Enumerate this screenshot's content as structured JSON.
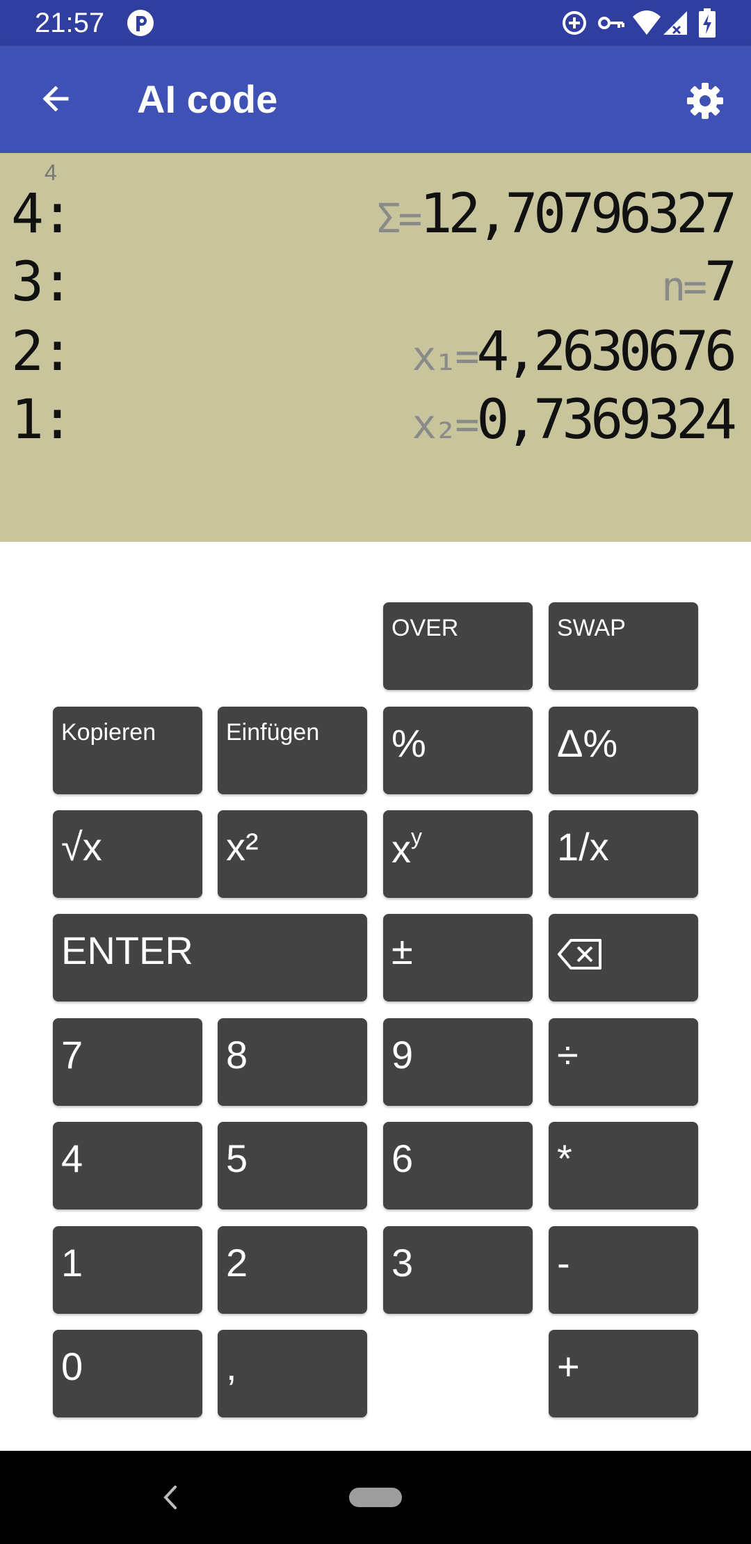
{
  "status_bar": {
    "time": "21:57",
    "icons": [
      "app-notification-icon",
      "data-saver-icon",
      "vpn-key-icon",
      "wifi-icon",
      "cell-signal-icon",
      "battery-charging-icon"
    ]
  },
  "app_bar": {
    "title": "AI code",
    "icons": [
      "back-arrow-icon",
      "gear-icon"
    ]
  },
  "display": {
    "stack_depth": "4",
    "stack": [
      {
        "index": "4:",
        "label": "Σ=",
        "value": "12,70796327"
      },
      {
        "index": "3:",
        "label": "n=",
        "value": "7"
      },
      {
        "index": "2:",
        "label": "x₁=",
        "value": "4,2630676"
      },
      {
        "index": "1:",
        "label": "x₂=",
        "value": "0,7369324"
      }
    ]
  },
  "keypad": {
    "over": "OVER",
    "swap": "SWAP",
    "kopieren": "Kopieren",
    "einfuegen": "Einfügen",
    "percent": "%",
    "delta_percent": "Δ%",
    "sqrt": "√x",
    "square": "x²",
    "power_base": "x",
    "power_exp": "y",
    "reciprocal": "1/x",
    "enter": "ENTER",
    "plus_minus": "±",
    "d7": "7",
    "d8": "8",
    "d9": "9",
    "divide": "÷",
    "d4": "4",
    "d5": "5",
    "d6": "6",
    "multiply": "*",
    "d1": "1",
    "d2": "2",
    "d3": "3",
    "minus": "-",
    "d0": "0",
    "comma": ",",
    "plus": "+"
  },
  "colors": {
    "status_bar": "#303f9f",
    "app_bar": "#3f51b5",
    "display_bg": "#c8c59d",
    "key_bg": "#434343"
  }
}
